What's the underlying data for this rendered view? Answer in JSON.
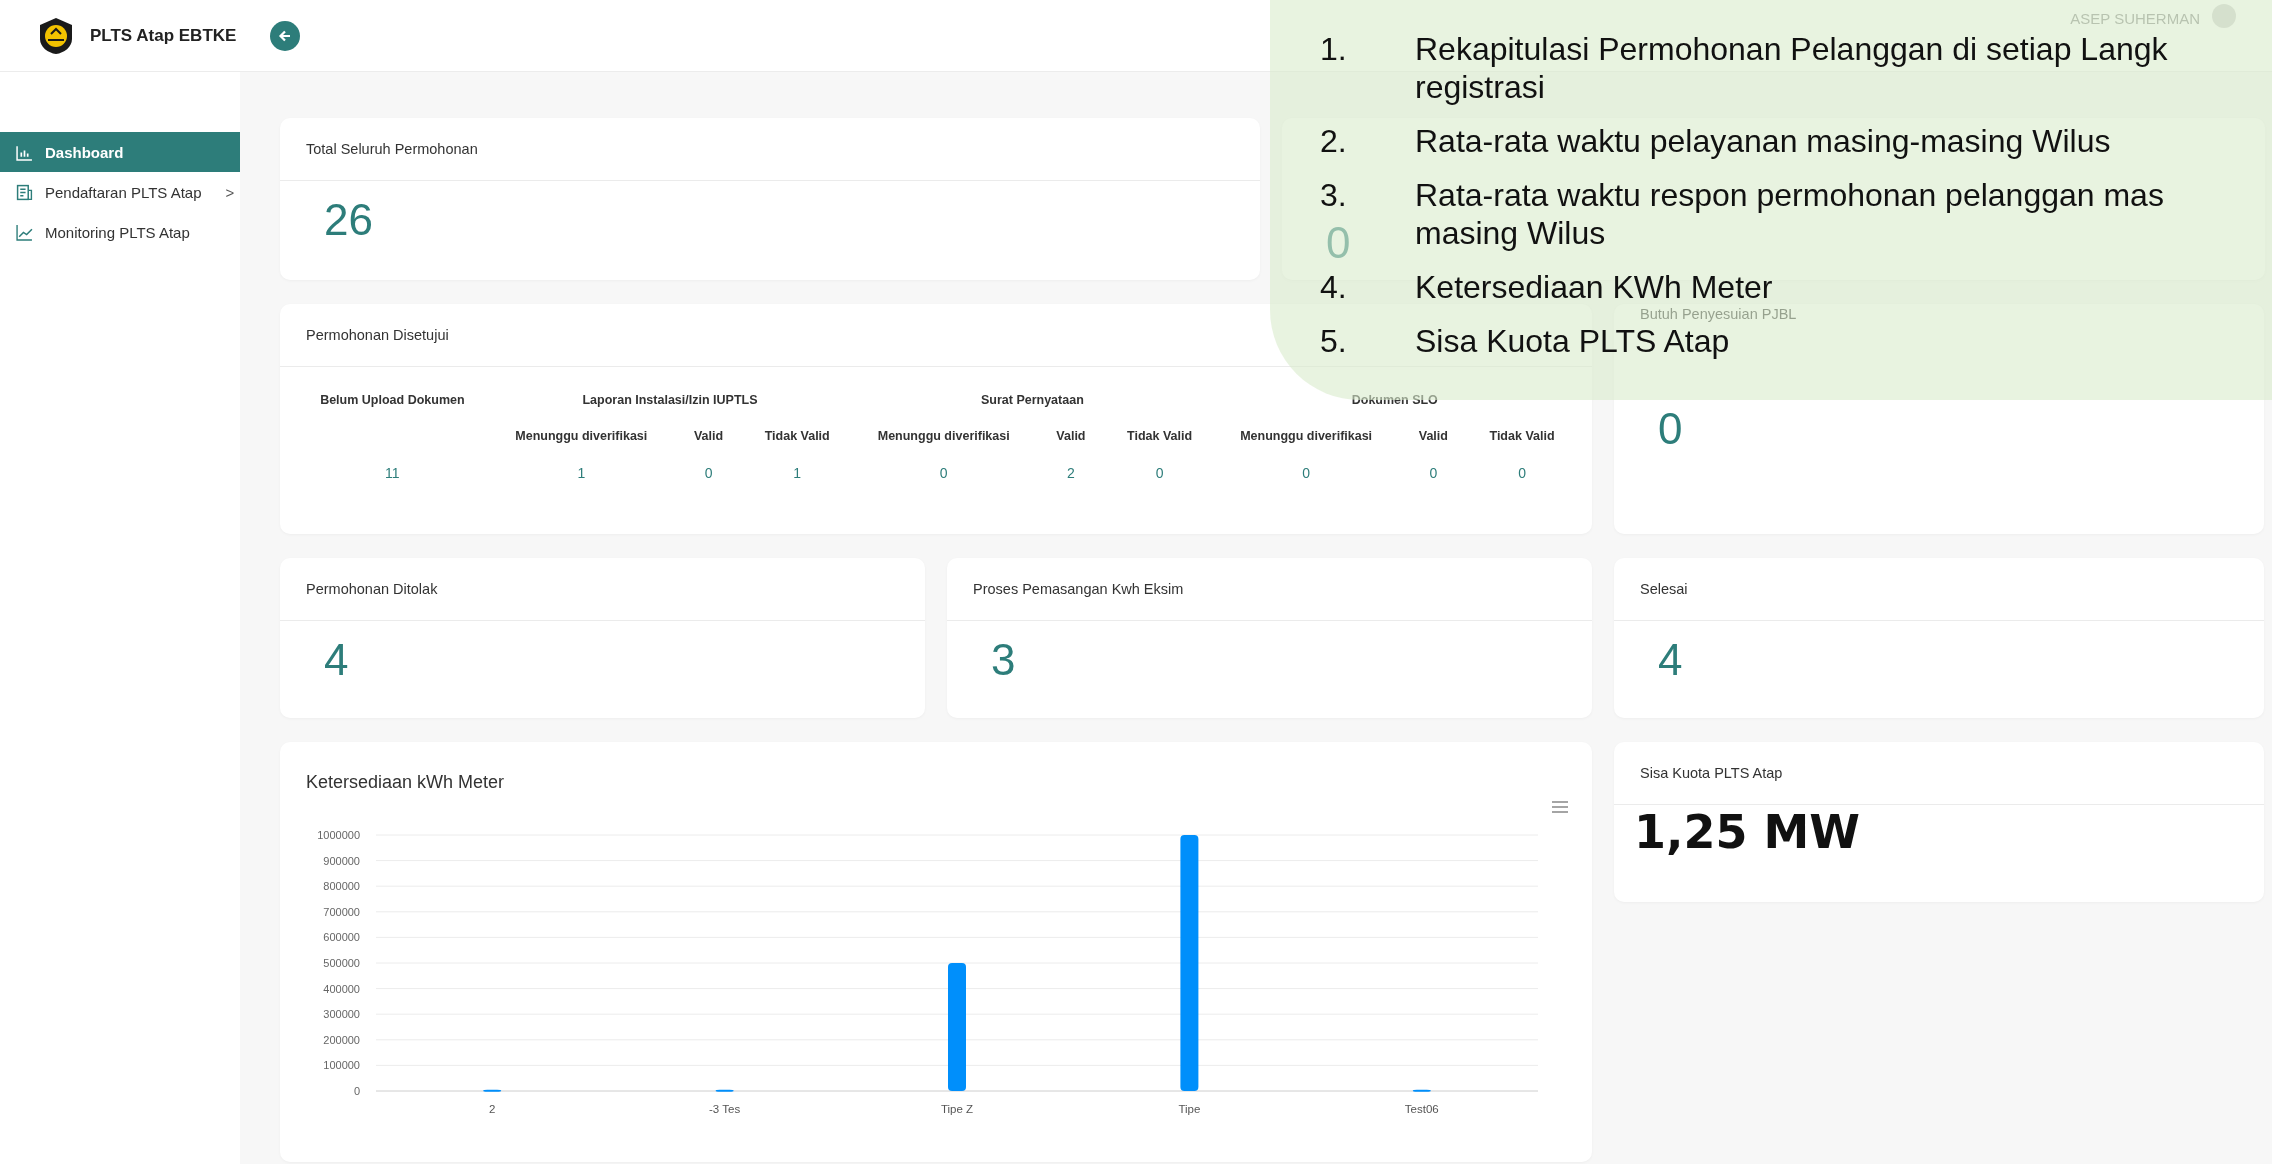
{
  "header": {
    "app_title": "PLTS Atap EBTKE",
    "user_name": "ASEP SUHERMAN"
  },
  "sidebar": {
    "items": [
      {
        "label": "Dashboard",
        "selected": true,
        "kind": "link"
      },
      {
        "label": "Pendaftaran PLTS Atap",
        "selected": false,
        "kind": "submenu",
        "chevron": ">"
      },
      {
        "label": "Monitoring PLTS Atap",
        "selected": false,
        "kind": "link"
      }
    ]
  },
  "total_card": {
    "title": "Total Seluruh Permohonan",
    "value": "26"
  },
  "pending_card": {
    "value": "0"
  },
  "approved_card": {
    "title": "Permohonan Disetujui",
    "groups": [
      {
        "title": "Belum Upload Dokumen",
        "columns": [
          {
            "value": "11"
          }
        ]
      },
      {
        "title": "Laporan Instalasi/Izin IUPTLS",
        "columns": [
          {
            "label": "Menunggu diverifikasi",
            "value": "1"
          },
          {
            "label": "Valid",
            "value": "0"
          },
          {
            "label": "Tidak Valid",
            "value": "1"
          }
        ]
      },
      {
        "title": "Surat Pernyataan",
        "columns": [
          {
            "label": "Menunggu diverifikasi",
            "value": "0"
          },
          {
            "label": "Valid",
            "value": "2"
          },
          {
            "label": "Tidak Valid",
            "value": "0"
          }
        ]
      },
      {
        "title": "Dokumen SLO",
        "columns": [
          {
            "label": "Menunggu diverifikasi",
            "value": "0"
          },
          {
            "label": "Valid",
            "value": "0"
          },
          {
            "label": "Tidak Valid",
            "value": "0"
          }
        ]
      }
    ]
  },
  "pjbl_card": {
    "title": "Butuh Penyesuian PJBL",
    "value": "0"
  },
  "stat_cards": [
    {
      "title": "Permohonan Ditolak",
      "value": "4"
    },
    {
      "title": "Proses Pemasangan Kwh Eksim",
      "value": "3"
    },
    {
      "title": "Selesai",
      "value": "4"
    }
  ],
  "chart_card": {
    "title": "Ketersediaan kWh Meter",
    "chart_data": {
      "type": "bar",
      "categories": [
        "2",
        "-3 Tes",
        "Tipe Z",
        "Tipe",
        "Test06"
      ],
      "series": [
        {
          "color": "#008ffb",
          "values": [
            5000,
            5000,
            500000,
            1000000,
            5000
          ]
        }
      ],
      "grid": true,
      "ylim": [
        0,
        1000000
      ],
      "yticks": [
        0,
        100000,
        200000,
        300000,
        400000,
        500000,
        600000,
        700000,
        800000,
        900000,
        1000000
      ]
    }
  },
  "quota_card": {
    "title": "Sisa Kuota PLTS Atap",
    "value": "1,25 MW"
  },
  "callout": {
    "items": [
      {
        "number": "1.",
        "text": "Rekapitulasi Permohonan Pelanggan di setiap Langk\nregistrasi"
      },
      {
        "number": "2.",
        "text": "Rata-rata waktu pelayanan masing-masing Wilus"
      },
      {
        "number": "3.",
        "text": "Rata-rata waktu respon permohonan pelanggan mas\nmasing Wilus"
      },
      {
        "number": "4.",
        "text": "Ketersediaan KWh Meter"
      },
      {
        "number": "5.",
        "text": "Sisa Kuota PLTS Atap"
      }
    ]
  }
}
